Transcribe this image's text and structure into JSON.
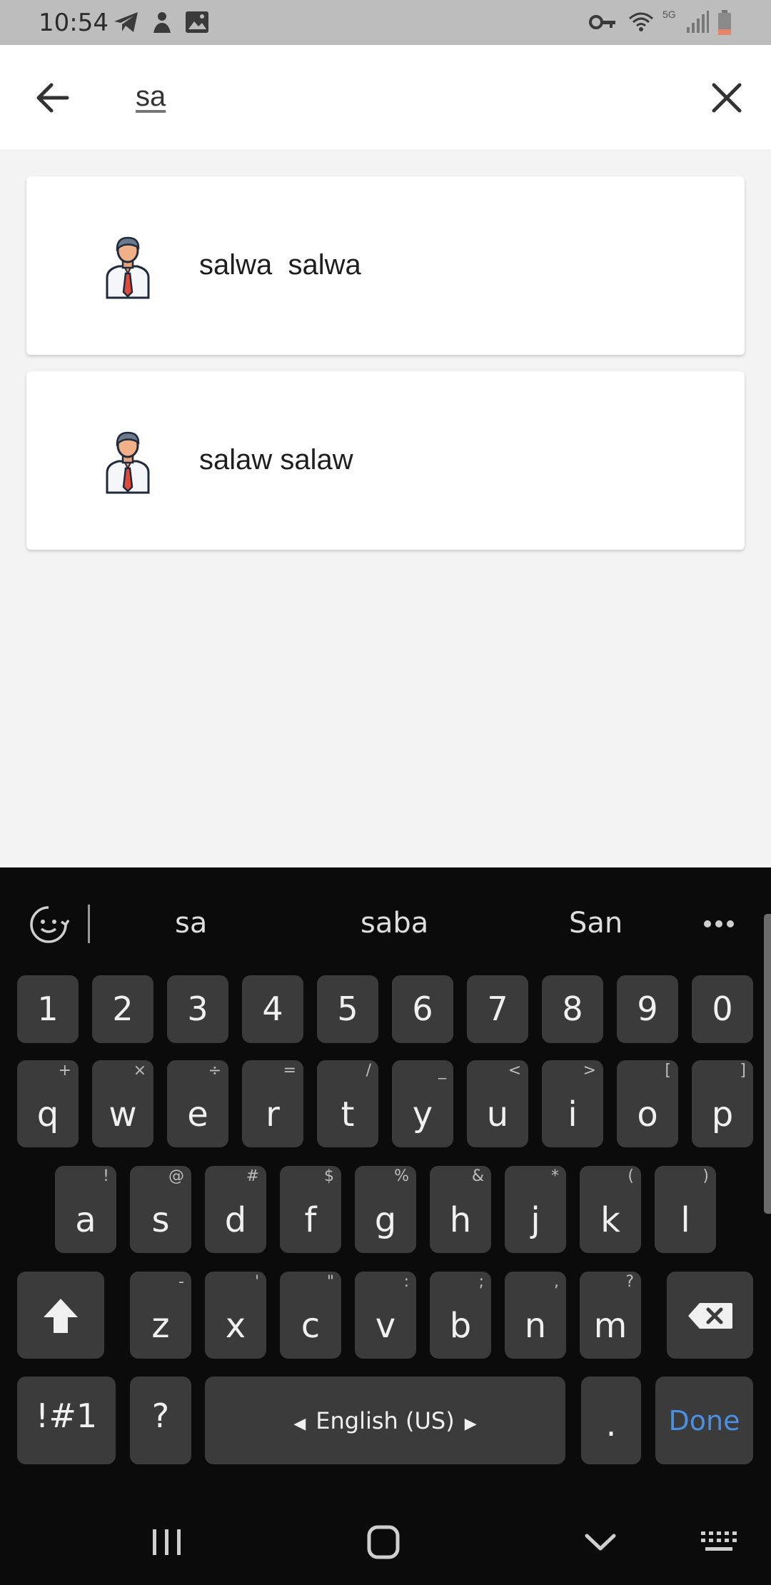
{
  "status_bar": {
    "time": "10:54",
    "network": "5G"
  },
  "search": {
    "query": "sa"
  },
  "results": [
    {
      "name": "salwa  salwa"
    },
    {
      "name": "salaw salaw"
    }
  ],
  "keyboard": {
    "suggestions": [
      "sa",
      "saba",
      "San"
    ],
    "number_row": [
      "1",
      "2",
      "3",
      "4",
      "5",
      "6",
      "7",
      "8",
      "9",
      "0"
    ],
    "row1": [
      {
        "key": "q",
        "alt": "+"
      },
      {
        "key": "w",
        "alt": "×"
      },
      {
        "key": "e",
        "alt": "÷"
      },
      {
        "key": "r",
        "alt": "="
      },
      {
        "key": "t",
        "alt": "/"
      },
      {
        "key": "y",
        "alt": "_"
      },
      {
        "key": "u",
        "alt": "<"
      },
      {
        "key": "i",
        "alt": ">"
      },
      {
        "key": "o",
        "alt": "["
      },
      {
        "key": "p",
        "alt": "]"
      }
    ],
    "row2": [
      {
        "key": "a",
        "alt": "!"
      },
      {
        "key": "s",
        "alt": "@"
      },
      {
        "key": "d",
        "alt": "#"
      },
      {
        "key": "f",
        "alt": "$"
      },
      {
        "key": "g",
        "alt": "%"
      },
      {
        "key": "h",
        "alt": "&"
      },
      {
        "key": "j",
        "alt": "*"
      },
      {
        "key": "k",
        "alt": "("
      },
      {
        "key": "l",
        "alt": ")"
      }
    ],
    "row3": [
      {
        "key": "z",
        "alt": "-"
      },
      {
        "key": "x",
        "alt": "'"
      },
      {
        "key": "c",
        "alt": "\""
      },
      {
        "key": "v",
        "alt": ":"
      },
      {
        "key": "b",
        "alt": ";"
      },
      {
        "key": "n",
        "alt": ","
      },
      {
        "key": "m",
        "alt": "?"
      }
    ],
    "symbols_label": "!#1",
    "question_label": "?",
    "space_label": "English (US)",
    "period_label": ".",
    "done_label": "Done",
    "done_color": "#4a8fe0"
  }
}
